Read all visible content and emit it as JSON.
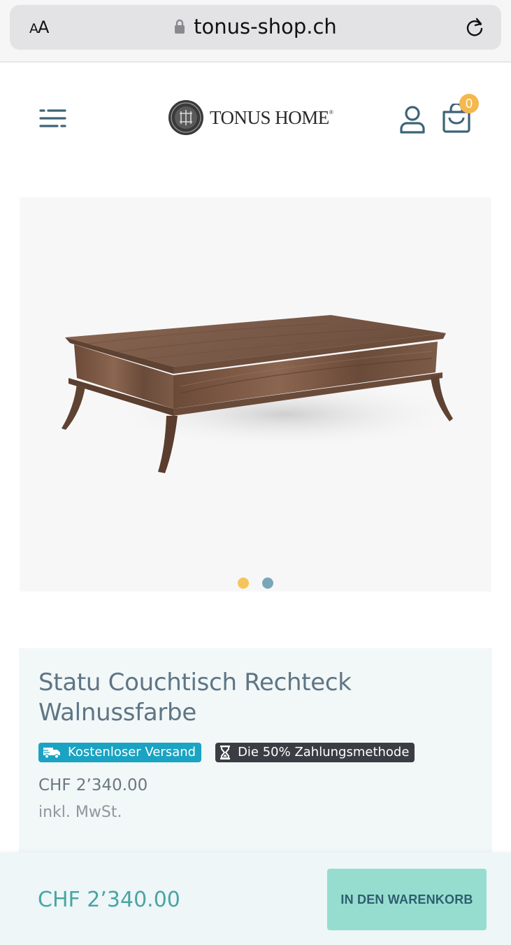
{
  "browser": {
    "text_size_label": "AA",
    "url": "tonus-shop.ch",
    "icons": {
      "lock": "lock-icon",
      "reload": "reload-icon"
    }
  },
  "header": {
    "logo_text": "TONUS HOME",
    "logo_mark": "®",
    "cart_count": "0",
    "icons": {
      "menu": "menu-icon",
      "user": "user-icon",
      "cart": "cart-icon"
    },
    "badge_color": "#f3b84e"
  },
  "gallery": {
    "image": "walnut-coffee-table",
    "slide_count": 2,
    "active_slide": 1,
    "dot_colors": [
      "#f5c55a",
      "#7aa6b8"
    ]
  },
  "product": {
    "title": "Statu Couchtisch Rechteck Walnussfarbe",
    "badges": [
      {
        "label": "Kostenloser Versand",
        "icon": "truck-icon",
        "color": "#1aa3c2"
      },
      {
        "label": "Die 50% Zahlungsmethode",
        "icon": "hourglass-icon",
        "color": "#3a3d43"
      }
    ],
    "price": "CHF 2’340.00",
    "vat_note": "inkl. MwSt."
  },
  "bottom_bar": {
    "price": "CHF 2’340.00",
    "add_to_cart_label": "IN DEN WARENKORB",
    "button_color": "#96ddd0"
  }
}
